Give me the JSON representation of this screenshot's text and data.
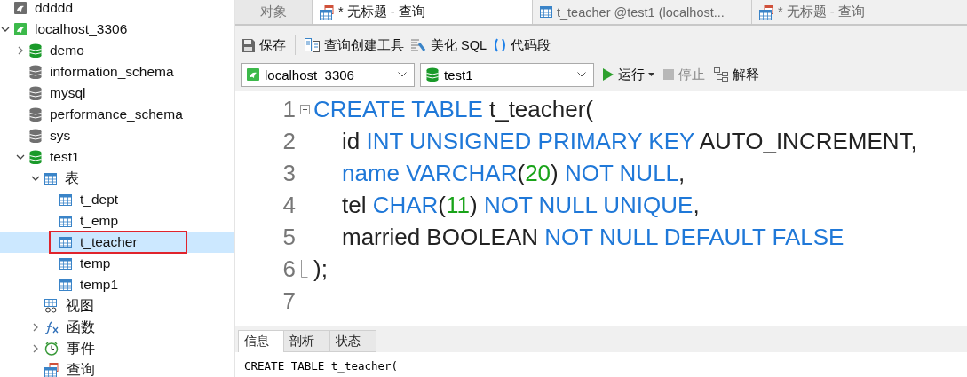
{
  "sidebar": {
    "tree": [
      {
        "label": "ddddd",
        "kind": "connection",
        "active": false,
        "selected": false
      },
      {
        "label": "localhost_3306",
        "kind": "connection",
        "active": true,
        "expanded": true,
        "selected": false,
        "children": [
          {
            "label": "demo",
            "kind": "database",
            "active": true,
            "expanded": false,
            "selected": false
          },
          {
            "label": "information_schema",
            "kind": "database",
            "active": false,
            "selected": false
          },
          {
            "label": "mysql",
            "kind": "database",
            "active": false,
            "selected": false
          },
          {
            "label": "performance_schema",
            "kind": "database",
            "active": false,
            "selected": false
          },
          {
            "label": "sys",
            "kind": "database",
            "active": false,
            "selected": false
          },
          {
            "label": "test1",
            "kind": "database",
            "active": true,
            "expanded": true,
            "selected": false,
            "children": [
              {
                "label": "表",
                "kind": "table",
                "expanded": true,
                "selected": false,
                "children": [
                  {
                    "label": "t_dept",
                    "kind": "table",
                    "selected": false
                  },
                  {
                    "label": "t_emp",
                    "kind": "table",
                    "selected": false
                  },
                  {
                    "label": "t_teacher",
                    "kind": "table",
                    "selected": true,
                    "highlighted": true
                  },
                  {
                    "label": "temp",
                    "kind": "table",
                    "selected": false
                  },
                  {
                    "label": "temp1",
                    "kind": "table",
                    "selected": false
                  }
                ]
              },
              {
                "label": "视图",
                "kind": "view",
                "selected": false
              },
              {
                "label": "函数",
                "kind": "function",
                "expanded": false,
                "selected": false
              },
              {
                "label": "事件",
                "kind": "event",
                "expanded": false,
                "selected": false
              },
              {
                "label": "查询",
                "kind": "query",
                "selected": false
              }
            ]
          }
        ]
      }
    ]
  },
  "tabs": [
    {
      "label": "对象",
      "kind": "plain",
      "selected": false
    },
    {
      "label": "* 无标题 - 查询",
      "kind": "query",
      "selected": true
    },
    {
      "label": "t_teacher @test1 (localhost...",
      "kind": "table",
      "selected": false
    },
    {
      "label": "* 无标题 - 查询",
      "kind": "query",
      "selected": false
    }
  ],
  "toolbar": [
    {
      "label": "保存",
      "kind": "save"
    },
    {
      "label": "查询创建工具",
      "kind": "builder"
    },
    {
      "label": "美化 SQL",
      "kind": "beautify"
    },
    {
      "label": "代码段",
      "kind": "snippet"
    }
  ],
  "connection_select": {
    "value": "localhost_3306"
  },
  "database_select": {
    "value": "test1"
  },
  "run_controls": [
    {
      "label": "运行",
      "kind": "run",
      "disabled": false,
      "dropdown": true
    },
    {
      "label": "停止",
      "kind": "stop",
      "disabled": true,
      "dropdown": false
    },
    {
      "label": "解释",
      "kind": "explain",
      "disabled": false,
      "dropdown": false
    }
  ],
  "editor": {
    "lines": [
      {
        "number": "1",
        "kind": "fold-start",
        "tokens": [
          {
            "kind": "kw",
            "text": "CREATE TABLE"
          },
          {
            "kind": "id",
            "text": " t_teacher("
          }
        ],
        "children": [
          {
            "number": "2",
            "tokens": [
              {
                "kind": "id",
                "text": "id "
              },
              {
                "kind": "kw",
                "text": "INT UNSIGNED PRIMARY KEY"
              },
              {
                "kind": "id",
                "text": " AUTO_INCREMENT,"
              }
            ]
          },
          {
            "number": "3",
            "tokens": [
              {
                "kind": "kw",
                "text": "name VARCHAR"
              },
              {
                "kind": "id",
                "text": "("
              },
              {
                "kind": "num",
                "text": "20"
              },
              {
                "kind": "id",
                "text": ") "
              },
              {
                "kind": "kw",
                "text": "NOT NULL"
              },
              {
                "kind": "id",
                "text": ","
              }
            ]
          },
          {
            "number": "4",
            "tokens": [
              {
                "kind": "id",
                "text": "tel "
              },
              {
                "kind": "kw",
                "text": "CHAR"
              },
              {
                "kind": "id",
                "text": "("
              },
              {
                "kind": "num",
                "text": "11"
              },
              {
                "kind": "id",
                "text": ") "
              },
              {
                "kind": "kw",
                "text": "NOT NULL UNIQUE"
              },
              {
                "kind": "id",
                "text": ","
              }
            ]
          },
          {
            "number": "5",
            "tokens": [
              {
                "kind": "id",
                "text": "married BOOLEAN "
              },
              {
                "kind": "kw",
                "text": "NOT NULL DEFAULT FALSE"
              }
            ]
          }
        ]
      },
      {
        "number": "6",
        "kind": "fold-end",
        "tokens": [
          {
            "kind": "id",
            "text": ");"
          }
        ]
      },
      {
        "number": "7"
      }
    ]
  },
  "result_tabs": [
    {
      "label": "信息",
      "selected": true
    },
    {
      "label": "剖析",
      "selected": false
    },
    {
      "label": "状态",
      "selected": false
    }
  ],
  "info_lines": [
    "CREATE TABLE t_teacher("
  ]
}
